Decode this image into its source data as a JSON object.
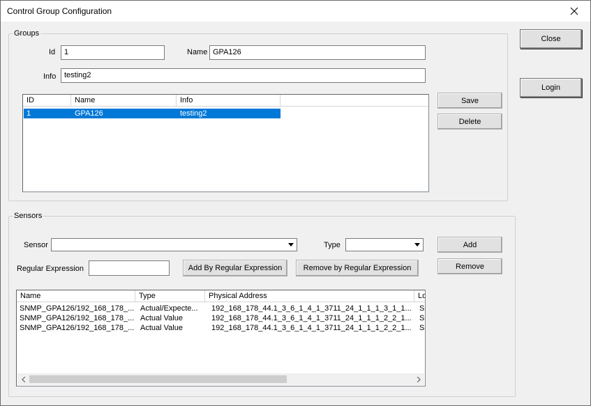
{
  "window": {
    "title": "Control Group Configuration"
  },
  "groups": {
    "label": "Groups",
    "id_label": "Id",
    "id_value": "1",
    "name_label": "Name",
    "name_value": "GPA126",
    "info_label": "Info",
    "info_value": "testing2",
    "columns": [
      "ID",
      "Name",
      "Info"
    ],
    "rows": [
      [
        "1",
        "GPA126",
        "testing2"
      ]
    ],
    "save_label": "Save",
    "delete_label": "Delete"
  },
  "side": {
    "close_label": "Close",
    "login_label": "Login"
  },
  "sensors": {
    "label": "Sensors",
    "sensor_label": "Sensor",
    "sensor_value": "",
    "type_label": "Type",
    "type_value": "",
    "regex_label": "Regular Expression",
    "regex_value": "",
    "add_by_regex_label": "Add By Regular Expression",
    "remove_by_regex_label": "Remove by Regular Expression",
    "add_label": "Add",
    "remove_label": "Remove",
    "columns": [
      "Name",
      "Type",
      "Physical Address",
      "Lo"
    ],
    "rows": [
      [
        "SNMP_GPA126/192_168_178_...",
        "Actual/Expecte...",
        "192_168_178_44.1_3_6_1_4_1_3711_24_1_1_1_3_1_1...",
        "SN"
      ],
      [
        "SNMP_GPA126/192_168_178_...",
        "Actual Value",
        "192_168_178_44.1_3_6_1_4_1_3711_24_1_1_1_2_2_1...",
        "SN"
      ],
      [
        "SNMP_GPA126/192_168_178_...",
        "Actual Value",
        "192_168_178_44.1_3_6_1_4_1_3711_24_1_1_1_2_2_1...",
        "SN"
      ]
    ]
  },
  "colors": {
    "selection": "#0078d7",
    "background": "#f0f0f0"
  }
}
